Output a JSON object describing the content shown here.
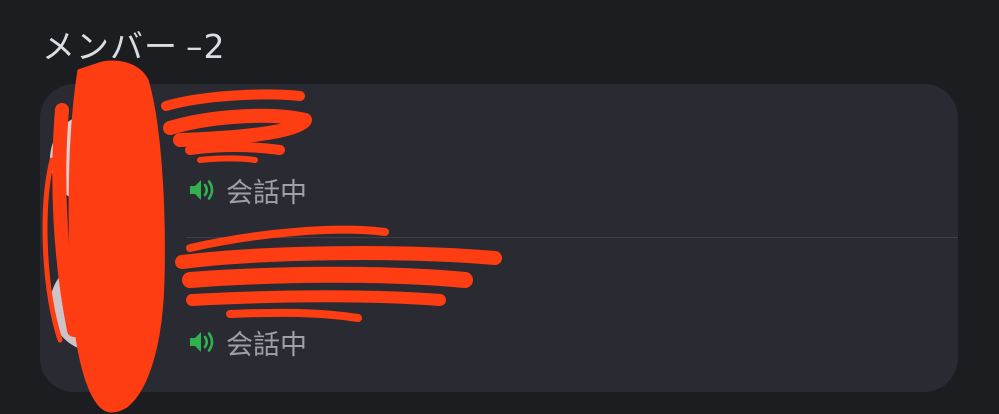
{
  "section": {
    "title": "メンバー",
    "separator": "–",
    "count": "2"
  },
  "members": [
    {
      "name": "",
      "status_icon": "speaker-icon",
      "status_label": "会話中"
    },
    {
      "name": "",
      "status_icon": "speaker-icon",
      "status_label": "会話中"
    }
  ],
  "colors": {
    "background": "#1c1d21",
    "card": "#2a2b32",
    "speaking_green": "#2fb14f",
    "redaction": "#ff3d12"
  }
}
